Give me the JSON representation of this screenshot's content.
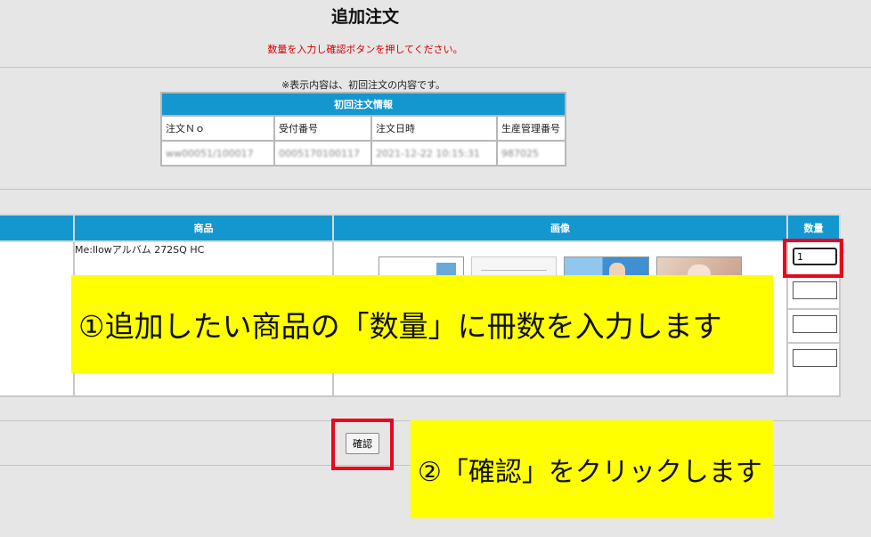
{
  "page": {
    "title": "追加注文",
    "instruction": "数量を入力し確認ボタンを押してください。",
    "note": "※表示内容は、初回注文の内容です。"
  },
  "first_order": {
    "header": "初回注文情報",
    "columns": [
      "注文Ｎｏ",
      "受付番号",
      "注文日時",
      "生産管理番号"
    ],
    "values": [
      "ww00051/100017",
      "0005170100117",
      "2021-12-22 10:15:31",
      "987025"
    ]
  },
  "products": {
    "columns": [
      "",
      "商品",
      "画像",
      "数量"
    ],
    "rows": [
      {
        "name": "Me:llowアルバム 272SQ HC"
      }
    ],
    "quantities": [
      "1",
      "",
      "",
      ""
    ]
  },
  "confirm_button": {
    "label": "確認"
  },
  "callouts": {
    "step1": "①追加したい商品の「数量」に冊数を入力します",
    "step2": "②「確認」をクリックします"
  },
  "colors": {
    "header_blue": "#1497cf",
    "highlight_red": "#e5091e",
    "callout_yellow": "#ffff00",
    "instruction_red": "#d40000"
  }
}
